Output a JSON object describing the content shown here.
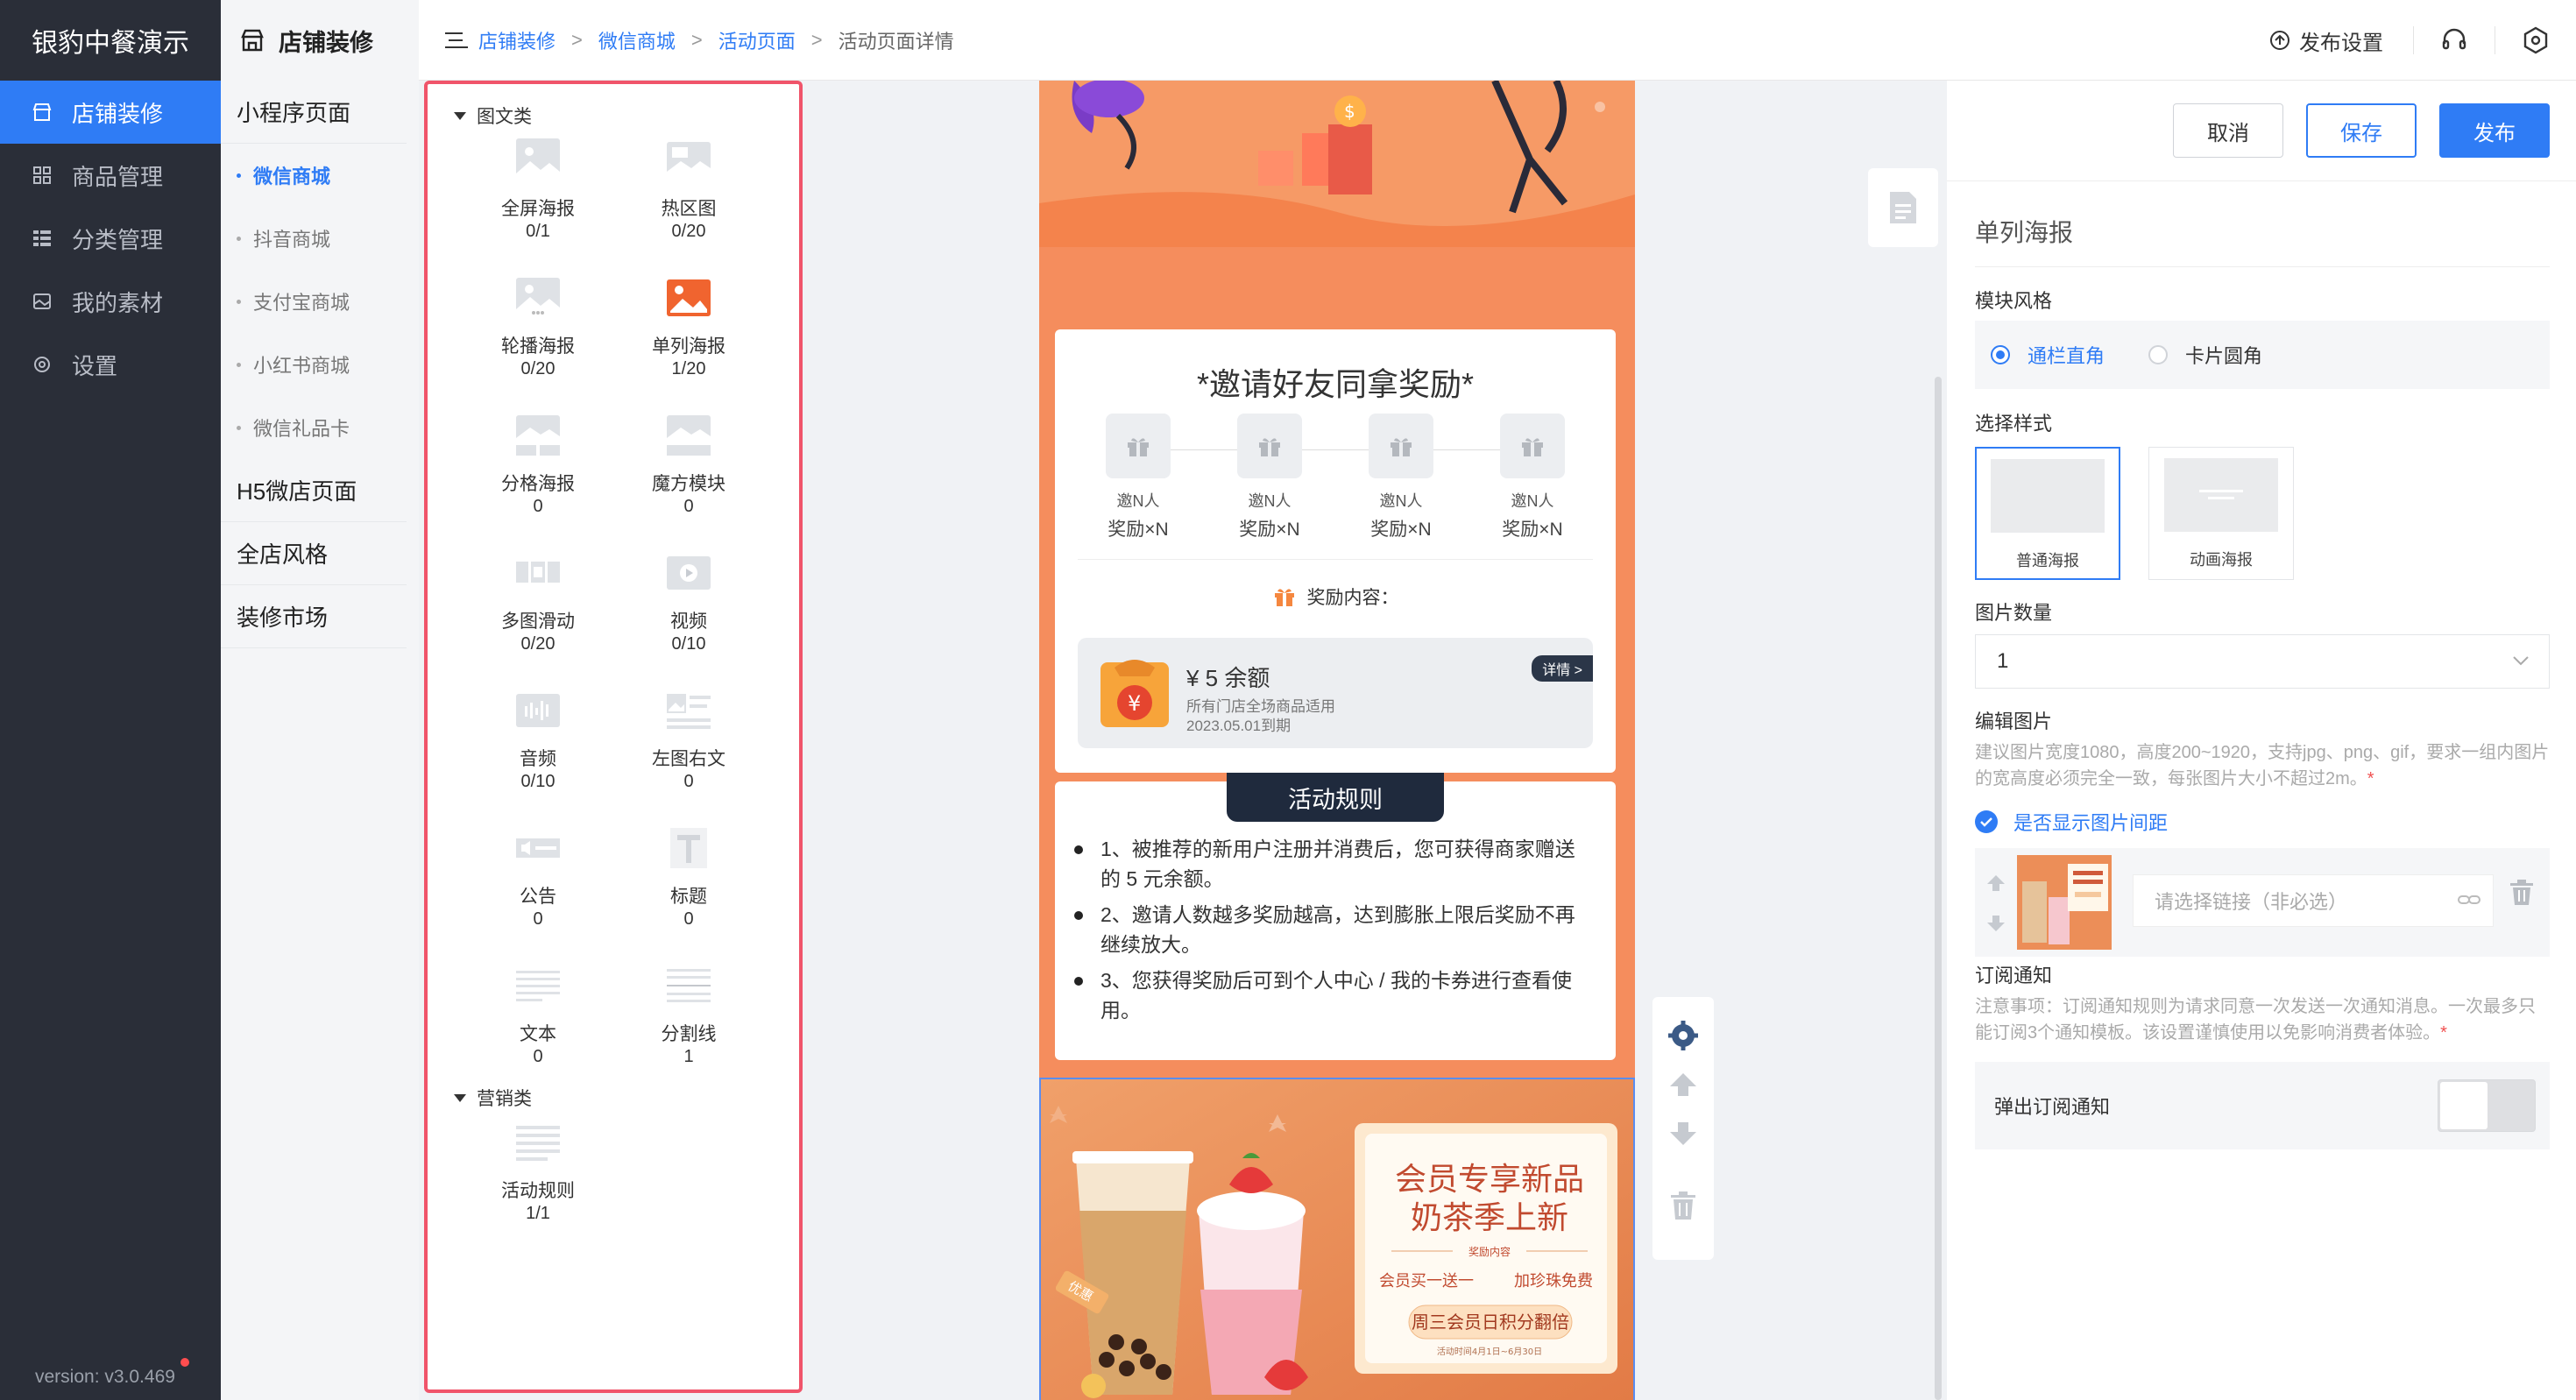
{
  "nav": {
    "brand": "银豹中餐演示",
    "items": [
      {
        "label": "店铺装修",
        "icon": "store-icon",
        "active": true
      },
      {
        "label": "商品管理",
        "icon": "grid-icon",
        "active": false
      },
      {
        "label": "分类管理",
        "icon": "list-icon",
        "active": false
      },
      {
        "label": "我的素材",
        "icon": "image-icon",
        "active": false
      },
      {
        "label": "设置",
        "icon": "gear-icon",
        "active": false
      }
    ],
    "version": "version: v3.0.469"
  },
  "subnav": {
    "title": "店铺装修",
    "groups": [
      {
        "label": "小程序页面",
        "children": [
          "微信商城",
          "抖音商城",
          "支付宝商城",
          "小红书商城",
          "微信礼品卡"
        ],
        "active_child": 0
      },
      {
        "label": "H5微店页面",
        "children": []
      },
      {
        "label": "全店风格",
        "children": []
      },
      {
        "label": "装修市场",
        "children": []
      }
    ]
  },
  "topbar": {
    "breadcrumb": [
      "店铺装修",
      "微信商城",
      "活动页面",
      "活动页面详情"
    ],
    "breadcrumb_sep": ">",
    "publish_settings": "发布设置"
  },
  "palette": {
    "categories": [
      {
        "label": "图文类",
        "components": [
          {
            "name": "全屏海报",
            "count": "0/1",
            "icon": "image-icon"
          },
          {
            "name": "热区图",
            "count": "0/20",
            "icon": "hotspot-image-icon"
          },
          {
            "name": "轮播海报",
            "count": "0/20",
            "icon": "carousel-icon"
          },
          {
            "name": "单列海报",
            "count": "1/20",
            "icon": "single-poster-icon",
            "highlight": true
          },
          {
            "name": "分格海报",
            "count": "0",
            "icon": "split-poster-icon"
          },
          {
            "name": "魔方模块",
            "count": "0",
            "icon": "cube-module-icon"
          },
          {
            "name": "多图滑动",
            "count": "0/20",
            "icon": "multi-image-slide-icon"
          },
          {
            "name": "视频",
            "count": "0/10",
            "icon": "video-icon"
          },
          {
            "name": "音频",
            "count": "0/10",
            "icon": "audio-icon"
          },
          {
            "name": "左图右文",
            "count": "0",
            "icon": "image-text-icon"
          },
          {
            "name": "公告",
            "count": "0",
            "icon": "announcement-icon"
          },
          {
            "name": "标题",
            "count": "0",
            "icon": "title-icon"
          },
          {
            "name": "文本",
            "count": "0",
            "icon": "text-icon"
          },
          {
            "name": "分割线",
            "count": "1",
            "icon": "divider-icon"
          }
        ]
      },
      {
        "label": "营销类",
        "components": [
          {
            "name": "活动规则",
            "count": "1/1",
            "icon": "rules-icon"
          }
        ]
      }
    ]
  },
  "preview": {
    "invite": {
      "title": "*邀请好友同拿奖励*",
      "steps": [
        {
          "line1": "邀N人",
          "line2": "奖励×N"
        },
        {
          "line1": "邀N人",
          "line2": "奖励×N"
        },
        {
          "line1": "邀N人",
          "line2": "奖励×N"
        },
        {
          "line1": "邀N人",
          "line2": "奖励×N"
        }
      ],
      "reward_label": "奖励内容：",
      "coupon": {
        "amount": "¥ 5 余额",
        "desc": "所有门店全场商品适用",
        "expiry": "2023.05.01到期",
        "detail": "详情 >"
      }
    },
    "rules": {
      "tag": "活动规则",
      "items": [
        "1、被推荐的新用户注册并消费后，您可获得商家赠送的 5 元余额。",
        "2、邀请人数越多奖励越高，达到膨胀上限后奖励不再继续放大。",
        "3、您获得奖励后可到个人中心 / 我的卡券进行查看使用。"
      ]
    },
    "poster": {
      "headline1": "会员专享新品",
      "headline2": "奶茶季上新",
      "sub_label": "奖励内容",
      "promo1": "会员买一送一",
      "promo2": "加珍珠免费",
      "promo3": "周三会员日积分翻倍",
      "footer": "活动时间4月1日~6月30日",
      "badge": "优惠"
    }
  },
  "props": {
    "buttons": {
      "cancel": "取消",
      "save": "保存",
      "publish": "发布"
    },
    "title": "单列海报",
    "module_style_label": "模块风格",
    "module_styles": [
      {
        "label": "通栏直角",
        "selected": true
      },
      {
        "label": "卡片圆角",
        "selected": false
      }
    ],
    "select_style_label": "选择样式",
    "styles": [
      {
        "label": "普通海报",
        "selected": true
      },
      {
        "label": "动画海报",
        "selected": false
      }
    ],
    "image_count_label": "图片数量",
    "image_count_value": "1",
    "edit_image_label": "编辑图片",
    "edit_image_hint": "建议图片宽度1080，高度200~1920，支持jpg、png、gif，要求一组内图片的宽高度必须完全一致，每张图片大小不超过2m。",
    "required_mark": "*",
    "show_spacing_label": "是否显示图片间距",
    "link_placeholder": "请选择链接（非必选）",
    "subscribe_label": "订阅通知",
    "subscribe_hint": "注意事项：订阅通知规则为请求同意一次发送一次通知消息。一次最多只能订阅3个通知模板。该设置谨慎使用以免影响消费者体验。",
    "popup_subscribe_label": "弹出订阅通知"
  },
  "colors": {
    "primary": "#2f7cf5",
    "nav_bg": "#2a2e38",
    "palette_border": "#f0546a",
    "activity_orange": "#f58d5d"
  }
}
